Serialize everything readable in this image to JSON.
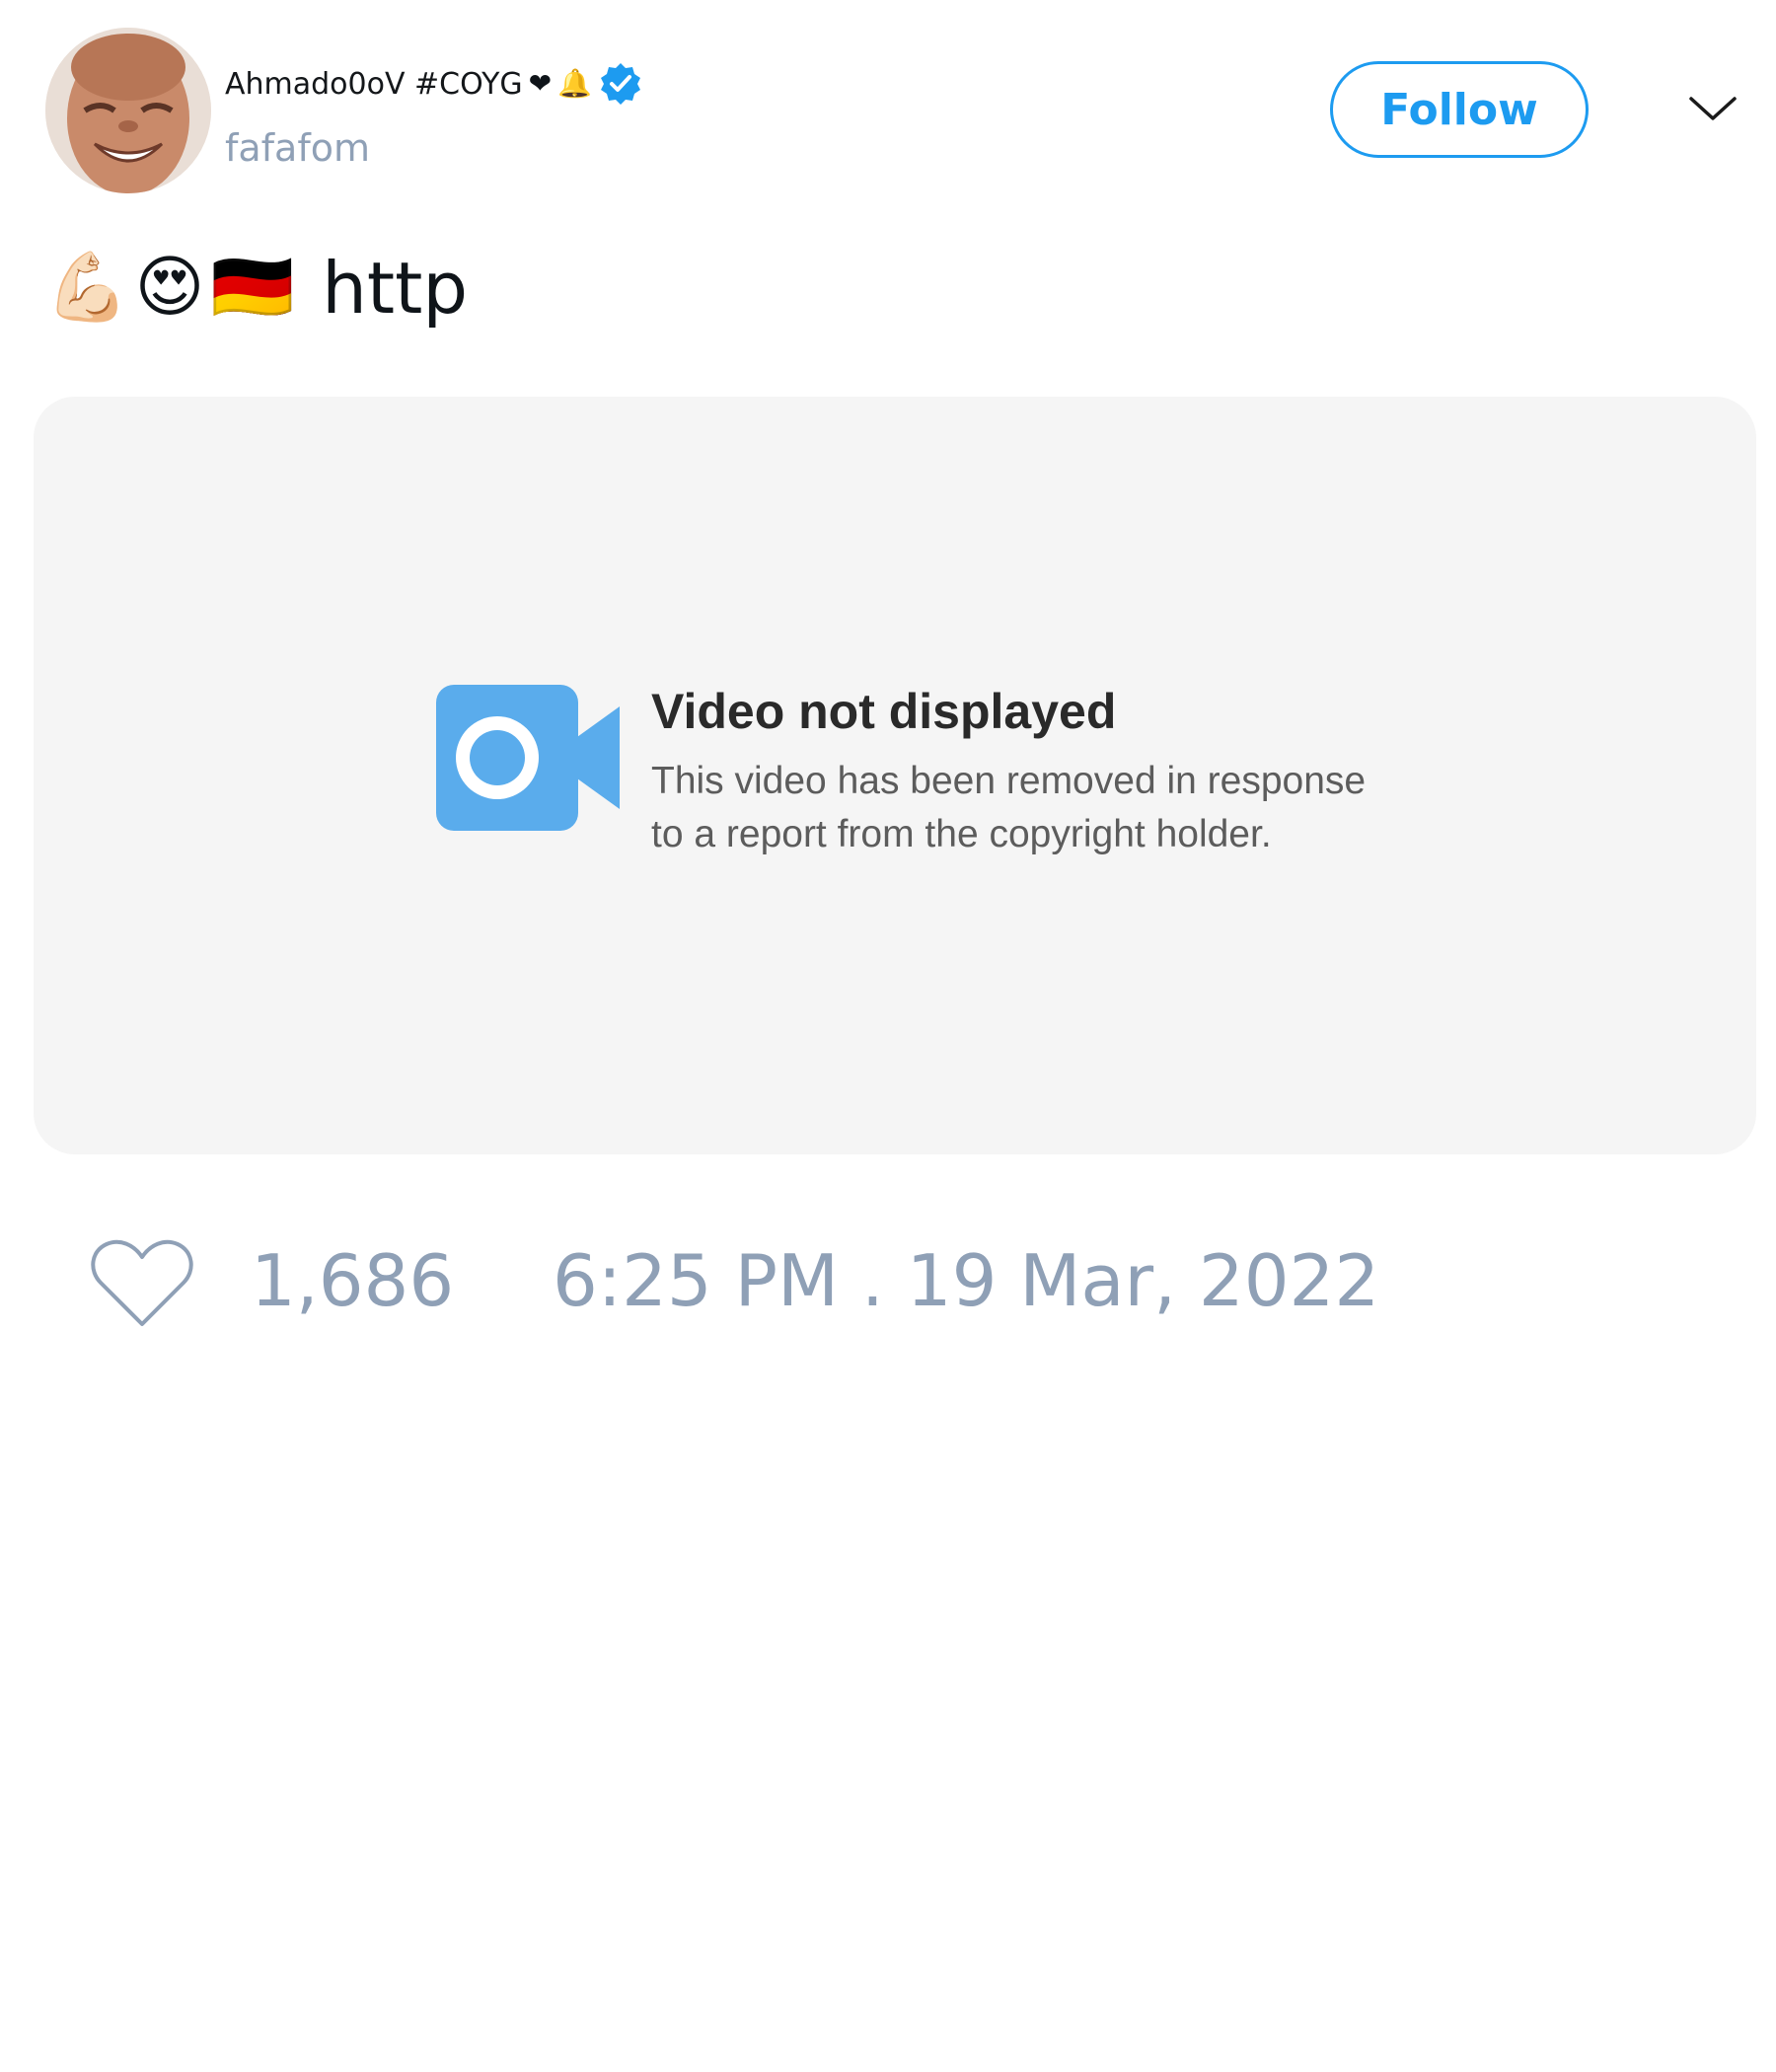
{
  "author": {
    "display_name": "Ahmado0oV #COYG",
    "name_emojis": [
      "❤",
      "🔔"
    ],
    "verified": true,
    "handle": "fafafom",
    "avatar_icon": "avatar-photo"
  },
  "header": {
    "follow_label": "Follow",
    "menu_icon": "chevron-down-icon"
  },
  "tweet": {
    "emojis": [
      "💪🏻",
      "😍",
      "🇩🇪"
    ],
    "link_text": "http"
  },
  "media": {
    "icon": "video-camera-icon",
    "title": "Video not displayed",
    "message_line_1": "This video has been removed in response",
    "message_line_2": "to a report from the copyright holder."
  },
  "footer": {
    "like_icon": "heart-icon",
    "like_count": "1,686",
    "timestamp": "6:25 PM . 19 Mar, 2022"
  },
  "colors": {
    "accent": "#1d9bf0",
    "muted_text": "#8fa0b6",
    "card_background": "#f5f5f5",
    "video_icon": "#5aacec"
  }
}
